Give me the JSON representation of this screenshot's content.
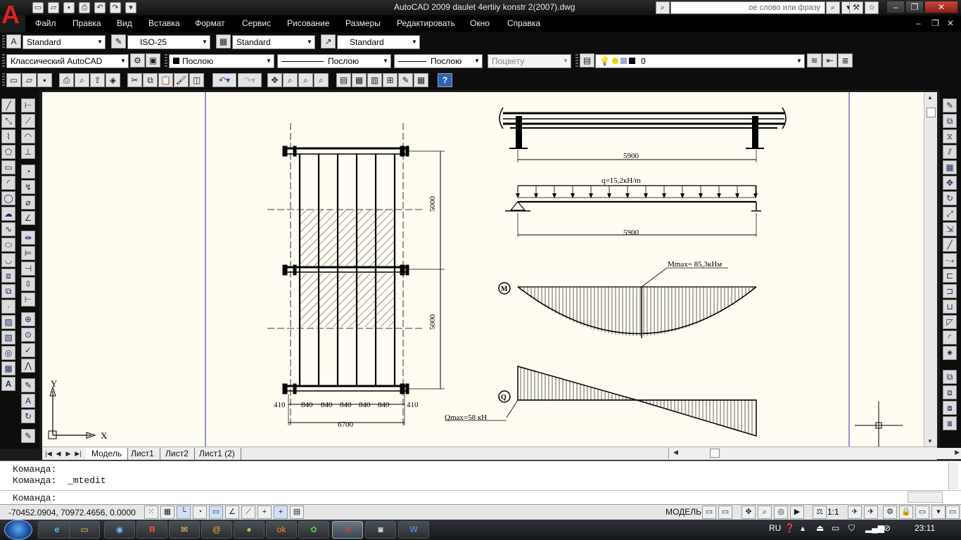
{
  "window": {
    "title": "AutoCAD 2009 daulet 4ertiiy konstr 2(2007).dwg",
    "search_placeholder": "ое слово или фразу",
    "controls": [
      "–",
      "❐",
      "✕"
    ]
  },
  "menu": {
    "items": [
      "Файл",
      "Правка",
      "Вид",
      "Вставка",
      "Формат",
      "Сервис",
      "Рисование",
      "Размеры",
      "Редактировать",
      "Окно",
      "Справка"
    ],
    "mdi_controls": [
      "–",
      "❐",
      "✕"
    ]
  },
  "styles_toolbar": {
    "text_style": "Standard",
    "dim_style": "ISO-25",
    "table_style": "Standard",
    "mleader_style": "Standard"
  },
  "props_toolbar": {
    "workspace": "Классический AutoCAD",
    "color": "Послою",
    "linetype": "Послою",
    "lineweight": "Послою",
    "plotstyle": "Поцвету",
    "layer": "0"
  },
  "drawing": {
    "dims": {
      "span_top": "5900",
      "span_mid": "5900",
      "plan_total": "6700",
      "plan_parts": [
        "410",
        "840",
        "840",
        "840",
        "840",
        "840",
        "410"
      ],
      "height_upper": "5000",
      "height_lower": "5000"
    },
    "load_label": "q=15,2кН/m",
    "moment_label": "Mmax= 85,3кНм",
    "moment_symbol": "M",
    "shear_label": "Qmax=58  кН",
    "shear_symbol": "Q",
    "ucs_x": "X",
    "ucs_y": "Y"
  },
  "tabs": {
    "items": [
      "Модель",
      "Лист1",
      "Лист2",
      "Лист1 (2)"
    ],
    "active": "Модель"
  },
  "command": {
    "history": [
      "Команда:",
      "Команда:  _mtedit"
    ],
    "prompt": "Команда:"
  },
  "status": {
    "coords": "-70452.0904, 70972.4656, 0.0000",
    "model_label": "МОДЕЛЬ",
    "scale": "1:1"
  },
  "taskbar": {
    "lang": "RU",
    "time": "23:11"
  }
}
